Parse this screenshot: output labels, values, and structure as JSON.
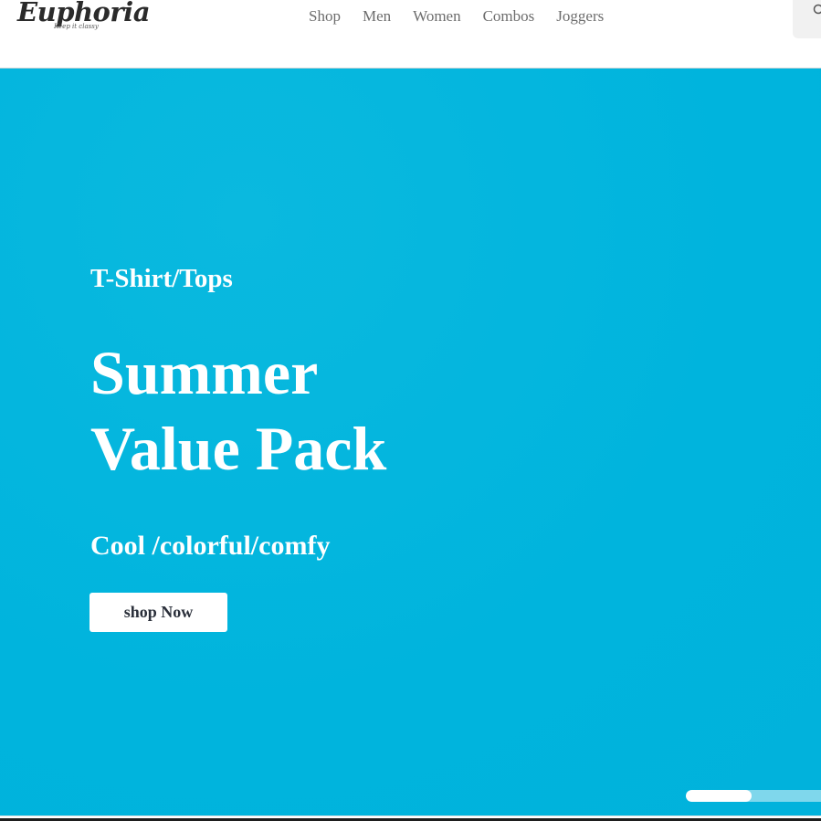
{
  "header": {
    "logo": {
      "name": "Euphoria",
      "tagline": "Keep it classy"
    },
    "nav": [
      {
        "label": "Shop"
      },
      {
        "label": "Men"
      },
      {
        "label": "Women"
      },
      {
        "label": "Combos"
      },
      {
        "label": "Joggers"
      }
    ],
    "search_icon": "search-icon"
  },
  "hero": {
    "category": "T-Shirt/Tops",
    "title_line1": "Summer",
    "title_line2": "Value Pack",
    "subtitle": "Cool /colorful/comfy",
    "button_label": "shop Now",
    "slider_progress": 0.45
  },
  "colors": {
    "hero_background": "#00b5de",
    "text_on_hero": "#ffffff",
    "nav_text": "#6d6d6d",
    "button_text": "#2a2f3a"
  }
}
